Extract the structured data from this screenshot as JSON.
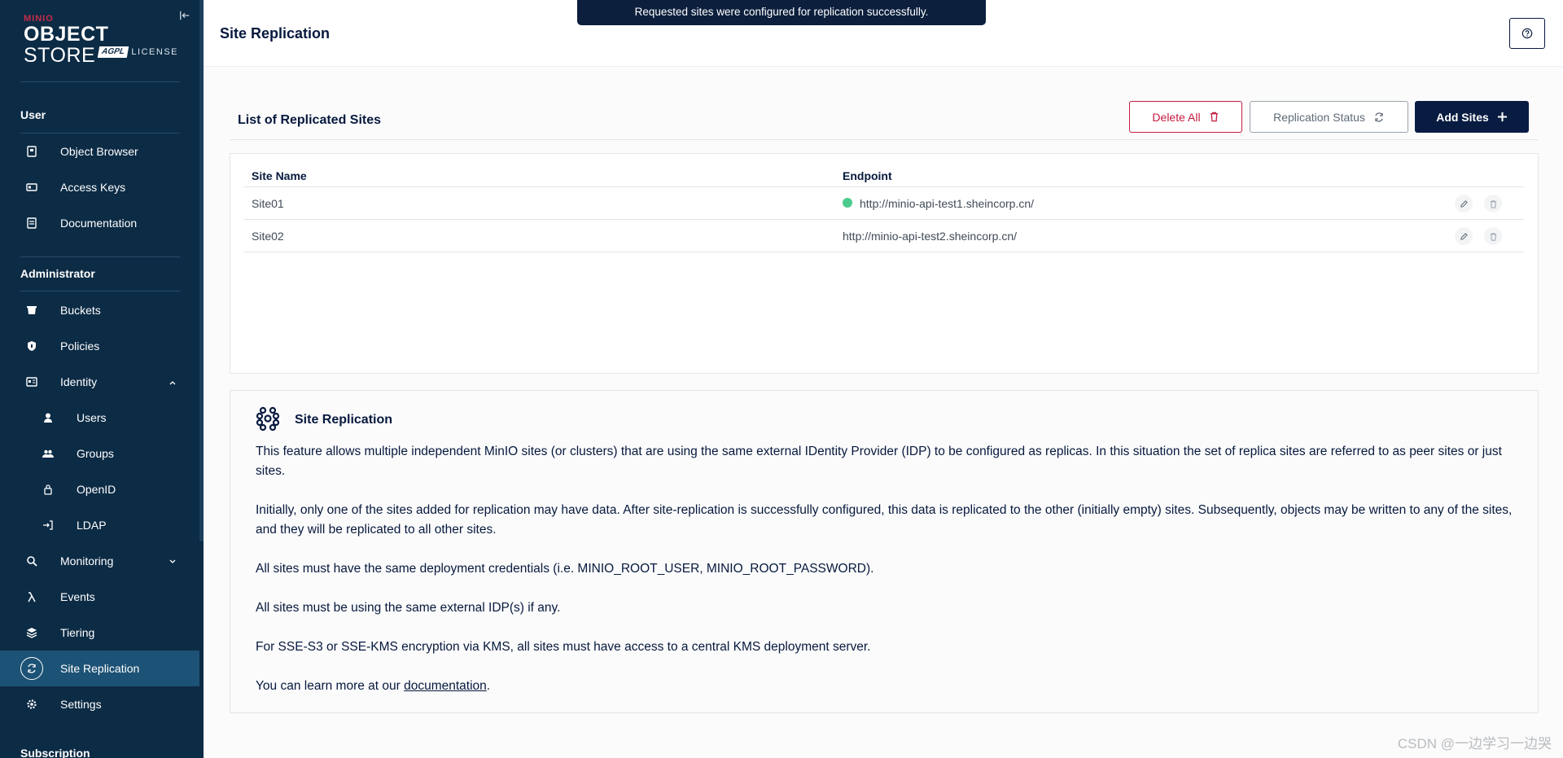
{
  "sidebar": {
    "logo": {
      "brand_small": "MINIO",
      "brand_big_bold": "OBJECT",
      "brand_big_thin": " STORE",
      "badge": "AGPL",
      "license": "LICENSE"
    },
    "sections": [
      {
        "label": "User"
      },
      {
        "label": "Administrator"
      },
      {
        "label": "Subscription"
      }
    ],
    "items": [
      {
        "label": "Object Browser",
        "icon": "object-browser-icon"
      },
      {
        "label": "Access Keys",
        "icon": "access-keys-icon"
      },
      {
        "label": "Documentation",
        "icon": "documentation-icon"
      },
      {
        "label": "Buckets",
        "icon": "buckets-icon"
      },
      {
        "label": "Policies",
        "icon": "policies-icon"
      },
      {
        "label": "Identity",
        "icon": "identity-icon",
        "expanded": true
      },
      {
        "label": "Users",
        "icon": "users-icon"
      },
      {
        "label": "Groups",
        "icon": "groups-icon"
      },
      {
        "label": "OpenID",
        "icon": "lock-icon"
      },
      {
        "label": "LDAP",
        "icon": "login-icon"
      },
      {
        "label": "Monitoring",
        "icon": "monitoring-icon",
        "expanded": false
      },
      {
        "label": "Events",
        "icon": "lambda-icon"
      },
      {
        "label": "Tiering",
        "icon": "tiering-icon"
      },
      {
        "label": "Site Replication",
        "icon": "site-replication-icon",
        "active": true
      },
      {
        "label": "Settings",
        "icon": "gear-icon"
      }
    ]
  },
  "header": {
    "title": "Site Replication",
    "toast": "Requested sites were configured for replication successfully."
  },
  "list": {
    "title": "List of Replicated Sites",
    "buttons": {
      "delete_all": "Delete All",
      "replication_status": "Replication Status",
      "add_sites": "Add Sites"
    },
    "columns": [
      "Site Name",
      "Endpoint"
    ],
    "rows": [
      {
        "name": "Site01",
        "endpoint": "http://minio-api-test1.sheincorp.cn/",
        "current": true
      },
      {
        "name": "Site02",
        "endpoint": "http://minio-api-test2.sheincorp.cn/",
        "current": false
      }
    ]
  },
  "info": {
    "title": "Site Replication",
    "paragraphs": [
      "This feature allows multiple independent MinIO sites (or clusters) that are using the same external IDentity Provider (IDP) to be configured as replicas. In this situation the set of replica sites are referred to as peer sites or just sites.",
      "Initially, only one of the sites added for replication may have data. After site-replication is successfully configured, this data is replicated to the other (initially empty) sites. Subsequently, objects may be written to any of the sites, and they will be replicated to all other sites.",
      "All sites must have the same deployment credentials (i.e. MINIO_ROOT_USER, MINIO_ROOT_PASSWORD).",
      "All sites must be using the same external IDP(s) if any.",
      "For SSE-S3 or SSE-KMS encryption via KMS, all sites must have access to a central KMS deployment server."
    ],
    "learn_more_prefix": "You can learn more at our ",
    "learn_more_link": "documentation",
    "learn_more_suffix": "."
  },
  "watermark": "CSDN @一边学习一边哭",
  "colors": {
    "sidebar_bg": "#0c2b45",
    "active_item": "#1c5275",
    "primary": "#081c42",
    "danger": "#c51b3f",
    "online": "#4ccb8d"
  }
}
